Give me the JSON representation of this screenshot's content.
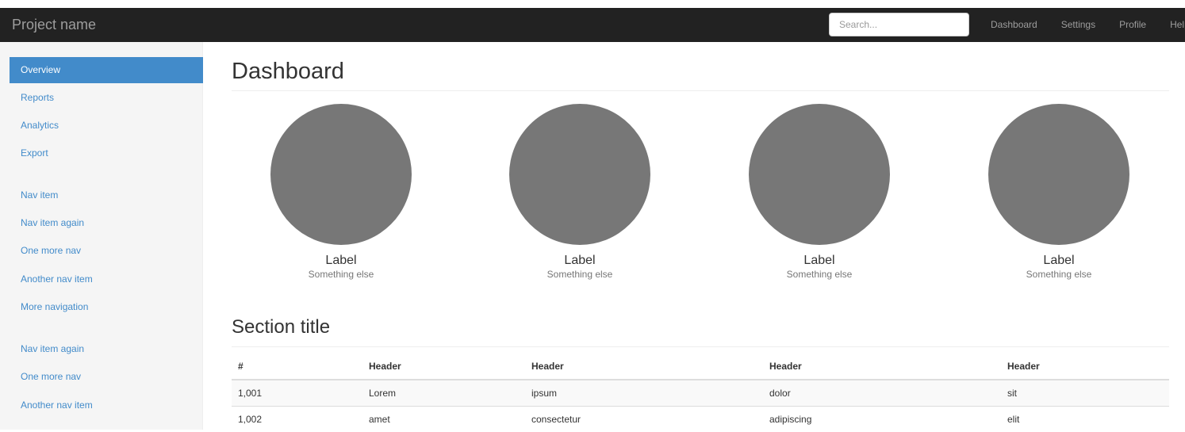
{
  "navbar": {
    "brand": "Project name",
    "search_placeholder": "Search...",
    "links": [
      "Dashboard",
      "Settings",
      "Profile",
      "Help"
    ]
  },
  "sidebar": {
    "items": [
      {
        "label": "Overview",
        "active": true
      },
      {
        "label": "Reports"
      },
      {
        "label": "Analytics"
      },
      {
        "label": "Export"
      },
      {
        "label": "Nav item"
      },
      {
        "label": "Nav item again"
      },
      {
        "label": "One more nav"
      },
      {
        "label": "Another nav item"
      },
      {
        "label": "More navigation"
      },
      {
        "label": "Nav item again"
      },
      {
        "label": "One more nav"
      },
      {
        "label": "Another nav item"
      }
    ]
  },
  "main": {
    "title": "Dashboard",
    "placeholders": [
      {
        "label": "Label",
        "sub": "Something else"
      },
      {
        "label": "Label",
        "sub": "Something else"
      },
      {
        "label": "Label",
        "sub": "Something else"
      },
      {
        "label": "Label",
        "sub": "Something else"
      }
    ],
    "section_title": "Section title",
    "table": {
      "headers": [
        "#",
        "Header",
        "Header",
        "Header",
        "Header"
      ],
      "rows": [
        [
          "1,001",
          "Lorem",
          "ipsum",
          "dolor",
          "sit"
        ],
        [
          "1,002",
          "amet",
          "consectetur",
          "adipiscing",
          "elit"
        ]
      ]
    }
  },
  "colors": {
    "navbar_bg": "#222222",
    "accent": "#428bca",
    "placeholder": "#777777"
  }
}
